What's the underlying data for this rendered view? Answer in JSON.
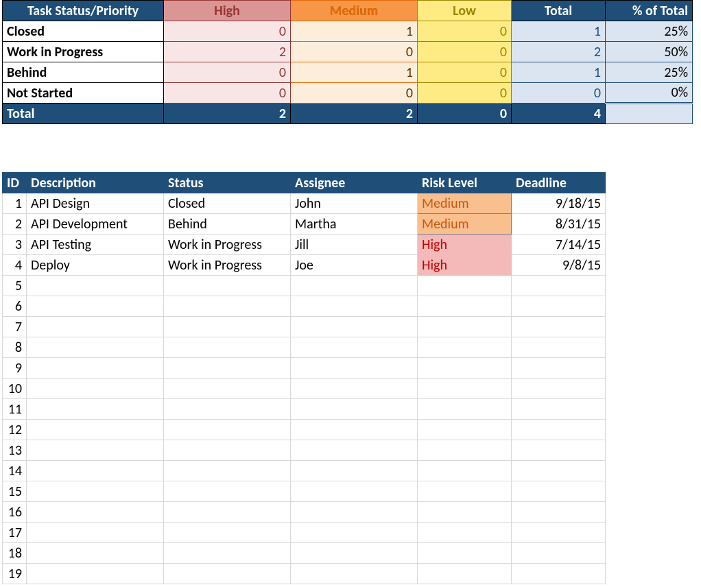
{
  "summary": {
    "headers": {
      "status_priority": "Task Status/Priority",
      "high": "High",
      "medium": "Medium",
      "low": "Low",
      "total": "Total",
      "pct": "% of Total"
    },
    "rows": [
      {
        "label": "Closed",
        "high": 0,
        "medium": 1,
        "low": 0,
        "total": 1,
        "pct": "25%"
      },
      {
        "label": "Work in Progress",
        "high": 2,
        "medium": 0,
        "low": 0,
        "total": 2,
        "pct": "50%"
      },
      {
        "label": "Behind",
        "high": 0,
        "medium": 1,
        "low": 0,
        "total": 1,
        "pct": "25%"
      },
      {
        "label": "Not Started",
        "high": 0,
        "medium": 0,
        "low": 0,
        "total": 0,
        "pct": "0%"
      }
    ],
    "totals": {
      "label": "Total",
      "high": 2,
      "medium": 2,
      "low": 0,
      "total": 4,
      "pct": ""
    }
  },
  "tasks": {
    "headers": {
      "id": "ID",
      "description": "Description",
      "status": "Status",
      "assignee": "Assignee",
      "risk": "Risk Level",
      "deadline": "Deadline"
    },
    "rows": [
      {
        "id": 1,
        "description": "API Design",
        "status": "Closed",
        "assignee": "John",
        "risk": "Medium",
        "deadline": "9/18/15"
      },
      {
        "id": 2,
        "description": "API Development",
        "status": "Behind",
        "assignee": "Martha",
        "risk": "Medium",
        "deadline": "8/31/15"
      },
      {
        "id": 3,
        "description": "API Testing",
        "status": "Work in Progress",
        "assignee": "Jill",
        "risk": "High",
        "deadline": "7/14/15"
      },
      {
        "id": 4,
        "description": "Deploy",
        "status": "Work in Progress",
        "assignee": "Joe",
        "risk": "High",
        "deadline": "9/8/15"
      },
      {
        "id": 5,
        "description": "",
        "status": "",
        "assignee": "",
        "risk": "",
        "deadline": ""
      },
      {
        "id": 6,
        "description": "",
        "status": "",
        "assignee": "",
        "risk": "",
        "deadline": ""
      },
      {
        "id": 7,
        "description": "",
        "status": "",
        "assignee": "",
        "risk": "",
        "deadline": ""
      },
      {
        "id": 8,
        "description": "",
        "status": "",
        "assignee": "",
        "risk": "",
        "deadline": ""
      },
      {
        "id": 9,
        "description": "",
        "status": "",
        "assignee": "",
        "risk": "",
        "deadline": ""
      },
      {
        "id": 10,
        "description": "",
        "status": "",
        "assignee": "",
        "risk": "",
        "deadline": ""
      },
      {
        "id": 11,
        "description": "",
        "status": "",
        "assignee": "",
        "risk": "",
        "deadline": ""
      },
      {
        "id": 12,
        "description": "",
        "status": "",
        "assignee": "",
        "risk": "",
        "deadline": ""
      },
      {
        "id": 13,
        "description": "",
        "status": "",
        "assignee": "",
        "risk": "",
        "deadline": ""
      },
      {
        "id": 14,
        "description": "",
        "status": "",
        "assignee": "",
        "risk": "",
        "deadline": ""
      },
      {
        "id": 15,
        "description": "",
        "status": "",
        "assignee": "",
        "risk": "",
        "deadline": ""
      },
      {
        "id": 16,
        "description": "",
        "status": "",
        "assignee": "",
        "risk": "",
        "deadline": ""
      },
      {
        "id": 17,
        "description": "",
        "status": "",
        "assignee": "",
        "risk": "",
        "deadline": ""
      },
      {
        "id": 18,
        "description": "",
        "status": "",
        "assignee": "",
        "risk": "",
        "deadline": ""
      },
      {
        "id": 19,
        "description": "",
        "status": "",
        "assignee": "",
        "risk": "",
        "deadline": ""
      }
    ]
  }
}
